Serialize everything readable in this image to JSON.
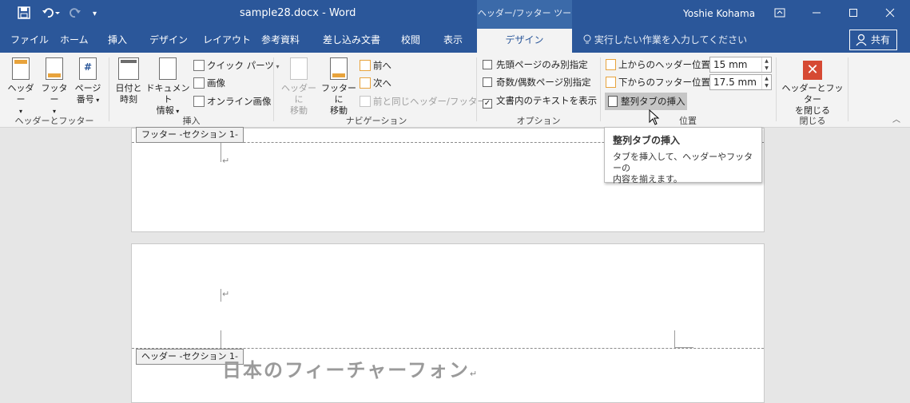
{
  "titlebar": {
    "doc_title": "sample28.docx - Word",
    "context_title": "ヘッダー/フッター ツール",
    "user_name": "Yoshie Kohama"
  },
  "tabs": [
    {
      "label": "ファイル"
    },
    {
      "label": "ホーム"
    },
    {
      "label": "挿入"
    },
    {
      "label": "デザイン"
    },
    {
      "label": "レイアウト"
    },
    {
      "label": "参考資料"
    },
    {
      "label": "差し込み文書"
    },
    {
      "label": "校閲"
    },
    {
      "label": "表示"
    },
    {
      "label": "デザイン"
    }
  ],
  "tell_me": "実行したい作業を入力してください",
  "share_label": "共有",
  "ribbon": {
    "header_footer": {
      "header_label": "ヘッダー",
      "footer_label": "フッター",
      "page_number_label_1": "ページ",
      "page_number_label_2": "番号",
      "group_label": "ヘッダーとフッター"
    },
    "insert": {
      "datetime_label_1": "日付と",
      "datetime_label_2": "時刻",
      "docinfo_label_1": "ドキュメント",
      "docinfo_label_2": "情報",
      "quick_parts": "クイック パーツ",
      "picture": "画像",
      "online_picture": "オンライン画像",
      "group_label": "挿入"
    },
    "navigation": {
      "goto_header_1": "ヘッダーに",
      "goto_header_2": "移動",
      "goto_footer_1": "フッターに",
      "goto_footer_2": "移動",
      "previous": "前へ",
      "next": "次へ",
      "link_previous": "前と同じヘッダー/フッター",
      "group_label": "ナビゲーション"
    },
    "options": {
      "first_page": "先頭ページのみ別指定",
      "odd_even": "奇数/偶数ページ別指定",
      "show_text": "文書内のテキストを表示",
      "show_text_checked": "✓",
      "group_label": "オプション"
    },
    "position": {
      "header_from_top": "上からのヘッダー位置:",
      "header_value": "15 mm",
      "footer_from_bottom": "下からのフッター位置:",
      "footer_value": "17.5 mm",
      "insert_align_tab": "整列タブの挿入",
      "group_label": "位置"
    },
    "close": {
      "close_label_1": "ヘッダーとフッター",
      "close_label_2": "を閉じる",
      "group_label": "閉じる"
    }
  },
  "tooltip": {
    "title": "整列タブの挿入",
    "body_1": "タブを挿入して、ヘッダーやフッターの",
    "body_2": "内容を揃えます。"
  },
  "document": {
    "footer_section_label": "フッター -セクション 1-",
    "header_section_label": "ヘッダー -セクション 1-",
    "para_mark": "↵",
    "heading": "日本のフィーチャーフォン"
  }
}
